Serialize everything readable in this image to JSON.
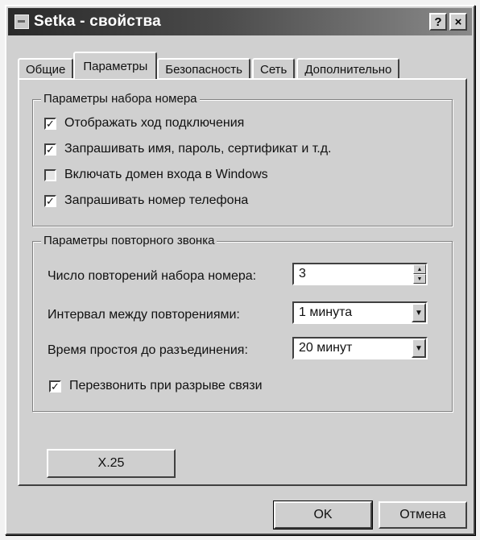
{
  "window": {
    "title": "Setka - свойства",
    "help_btn": "?",
    "close_btn": "×"
  },
  "tabs": [
    "Общие",
    "Параметры",
    "Безопасность",
    "Сеть",
    "Дополнительно"
  ],
  "active_tab": "Параметры",
  "dial_group": {
    "title": "Параметры набора номера",
    "options": [
      {
        "label": "Отображать ход подключения",
        "checked": true
      },
      {
        "label": "Запрашивать имя, пароль, сертификат и т.д.",
        "checked": true
      },
      {
        "label": "Включать домен входа в Windows",
        "checked": false
      },
      {
        "label": "Запрашивать номер телефона",
        "checked": true
      }
    ]
  },
  "redial_group": {
    "title": "Параметры повторного звонка",
    "attempts_label": "Число повторений набора номера:",
    "attempts_value": "3",
    "interval_label": "Интервал между повторениями:",
    "interval_value": "1 минута",
    "idle_label": "Время простоя до разъединения:",
    "idle_value": "20 минут",
    "reconnect_label": "Перезвонить при разрыве связи",
    "reconnect_checked": true
  },
  "x25_button": "X.25",
  "ok_button": "OK",
  "cancel_button": "Отмена",
  "check_glyph": "✓",
  "icons": {
    "spin_up": "▲",
    "spin_down": "▼",
    "dropdown": "▼"
  }
}
